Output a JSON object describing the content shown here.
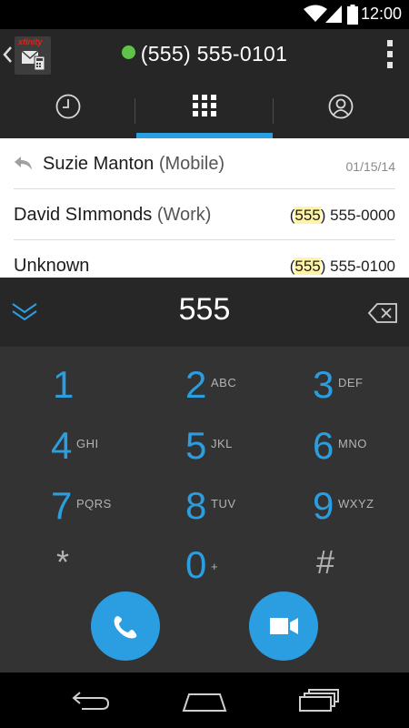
{
  "status": {
    "time": "12:00"
  },
  "actionbar": {
    "brand": "xfinity",
    "number": "(555) 555-0101",
    "presence_color": "#5fc34a"
  },
  "tabs": [
    {
      "icon": "clock-icon",
      "name": "recent"
    },
    {
      "icon": "dialpad-icon",
      "name": "dialpad",
      "active": true
    },
    {
      "icon": "contacts-icon",
      "name": "contacts"
    }
  ],
  "list": [
    {
      "icon": "reply-icon",
      "name": "Suzie Manton",
      "type": "(Mobile)",
      "date": "01/15/14"
    },
    {
      "name": "David SImmonds",
      "type": "(Work)",
      "match": "555",
      "rest": " 555-0000"
    },
    {
      "name": "Unknown",
      "type": "",
      "match": "555",
      "rest": " 555-0100"
    }
  ],
  "dialer": {
    "entered": "555",
    "keys": [
      {
        "digit": "1",
        "letters": ""
      },
      {
        "digit": "2",
        "letters": "ABC"
      },
      {
        "digit": "3",
        "letters": "DEF"
      },
      {
        "digit": "4",
        "letters": "GHI"
      },
      {
        "digit": "5",
        "letters": "JKL"
      },
      {
        "digit": "6",
        "letters": "MNO"
      },
      {
        "digit": "7",
        "letters": "PQRS"
      },
      {
        "digit": "8",
        "letters": "TUV"
      },
      {
        "digit": "9",
        "letters": "WXYZ"
      },
      {
        "digit": "*",
        "letters": ""
      },
      {
        "digit": "0",
        "letters": "+"
      },
      {
        "digit": "#",
        "letters": ""
      }
    ]
  },
  "colors": {
    "accent": "#2a9ee1",
    "highlight": "#fff3a8"
  }
}
